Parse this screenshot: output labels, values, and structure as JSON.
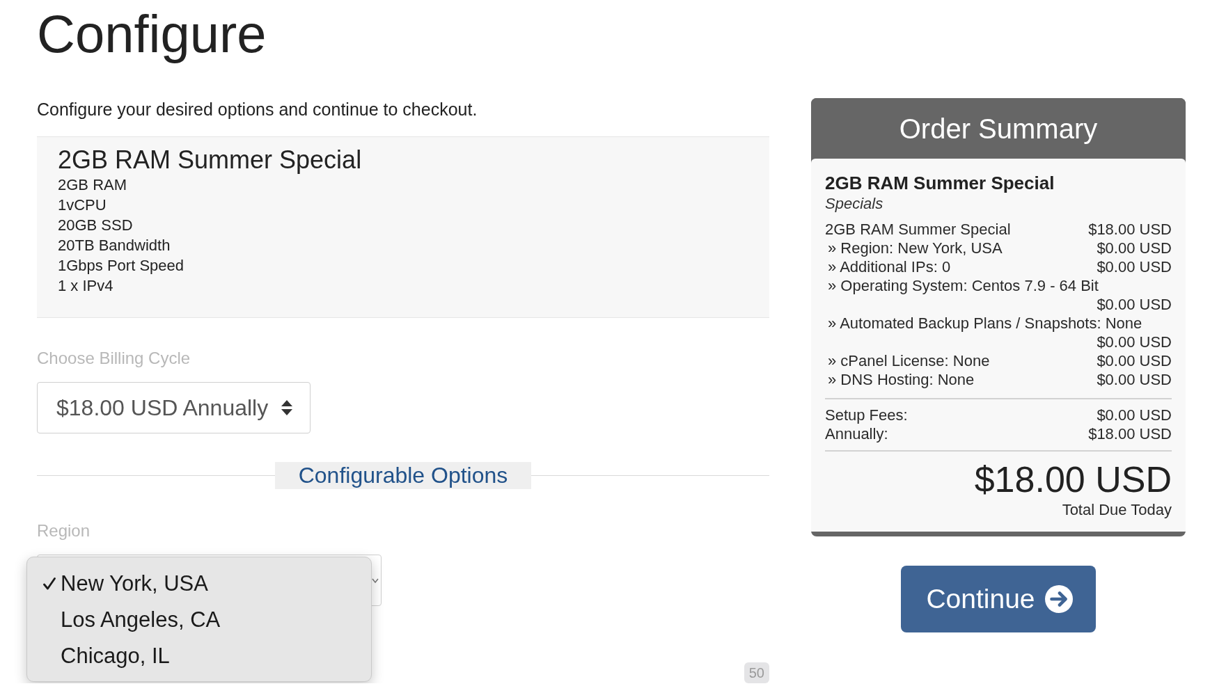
{
  "page": {
    "title": "Configure",
    "subtitle": "Configure your desired options and continue to checkout."
  },
  "product": {
    "name": "2GB RAM Summer Special",
    "features": [
      "2GB RAM",
      "1vCPU",
      "20GB SSD",
      "20TB Bandwidth",
      "1Gbps Port Speed",
      "1 x IPv4"
    ]
  },
  "billing_cycle": {
    "label": "Choose Billing Cycle",
    "value": "$18.00 USD Annually"
  },
  "configurable_options": {
    "heading": "Configurable Options",
    "region": {
      "label": "Region",
      "dropdown": {
        "expanded": true,
        "options": [
          {
            "label": "New York, USA",
            "selected": true
          },
          {
            "label": "Los Angeles, CA",
            "selected": false
          },
          {
            "label": "Chicago, IL",
            "selected": false
          }
        ]
      }
    }
  },
  "badge": {
    "text": "50"
  },
  "order_summary": {
    "title": "Order Summary",
    "product_name": "2GB RAM Summer Special",
    "product_group": "Specials",
    "items": [
      {
        "kind": "product",
        "label": "2GB RAM Summer Special",
        "price": "$18.00 USD"
      },
      {
        "kind": "option",
        "label": "» Region: New York, USA",
        "price": "$0.00 USD"
      },
      {
        "kind": "option",
        "label": "» Additional IPs: 0",
        "price": "$0.00 USD"
      },
      {
        "kind": "option",
        "label": "» Operating System: Centos 7.9 - 64 Bit",
        "price": "$0.00 USD"
      },
      {
        "kind": "option",
        "label": "» Automated Backup Plans / Snapshots: None",
        "price": "$0.00 USD"
      },
      {
        "kind": "option",
        "label": "» cPanel License: None",
        "price": "$0.00 USD"
      },
      {
        "kind": "option",
        "label": "» DNS Hosting: None",
        "price": "$0.00 USD"
      }
    ],
    "totals": [
      {
        "label": "Setup Fees:",
        "amount": "$0.00 USD"
      },
      {
        "label": "Annually:",
        "amount": "$18.00 USD"
      }
    ],
    "total_due": {
      "amount": "$18.00 USD",
      "label": "Total Due Today"
    }
  },
  "continue_button": {
    "label": "Continue"
  }
}
